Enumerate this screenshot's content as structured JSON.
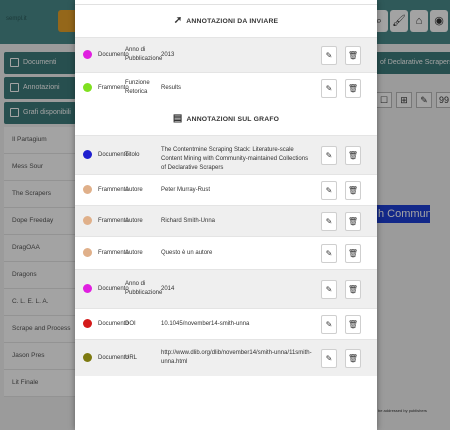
{
  "background": {
    "brand": "sempl.it",
    "top_icons": [
      {
        "icon": "search-icon",
        "glyph": "⌕"
      },
      {
        "icon": "brush-icon",
        "glyph": "🖌"
      },
      {
        "icon": "home-icon",
        "glyph": "⌂"
      },
      {
        "icon": "eye-icon",
        "glyph": "◉"
      }
    ],
    "sidebar": {
      "headers": [
        "Documenti",
        "Annotazioni",
        "Grafi disponibili"
      ],
      "items": [
        "Il Partagium",
        "Mess Sour",
        "The Scrapers",
        "Dope Freeday",
        "DragOAA",
        "Dragons",
        "C. L. E. L. A.",
        "Scrape and Process",
        "Jason Pres",
        "Lit Finale"
      ]
    },
    "right_panel": {
      "title": "of Declarative Scrapers",
      "tools": [
        "☐",
        "⊞",
        "✎",
        "99"
      ],
      "highlight_text": "h Community-",
      "note": "be addressed by publishers"
    }
  },
  "modal": {
    "sections": [
      {
        "title": "ANNOTAZIONI DA INVIARE",
        "icon": "➚",
        "icon_name": "send-icon",
        "rows": [
          {
            "color": "#e020e0",
            "type": "Documento",
            "property": "Anno di Pubblicazione",
            "value": "2013"
          },
          {
            "color": "#80e020",
            "type": "Frammento",
            "property": "Funzione Retorica",
            "value": "Results"
          }
        ]
      },
      {
        "title": "ANNOTAZIONI SUL GRAFO",
        "icon": "▤",
        "icon_name": "database-icon",
        "rows": [
          {
            "color": "#1f1fcf",
            "type": "Documento",
            "property": "Titolo",
            "value": "The Contentmine Scraping Stack: Literature-scale Content Mining with Community-maintained Collections of Declarative Scrapers"
          },
          {
            "color": "#e0b08a",
            "type": "Frammento",
            "property": "Autore",
            "value": "Peter Murray-Rust"
          },
          {
            "color": "#e0b08a",
            "type": "Frammento",
            "property": "Autore",
            "value": "Richard Smith-Unna"
          },
          {
            "color": "#e0b08a",
            "type": "Frammento",
            "property": "Autore",
            "value": "Questo è un autore"
          },
          {
            "color": "#e020e0",
            "type": "Documento",
            "property": "Anno di Pubblicazione",
            "value": "2014"
          },
          {
            "color": "#d41a1a",
            "type": "Documento",
            "property": "DOI",
            "value": "10.1045/november14-smith-unna"
          },
          {
            "color": "#7d7a10",
            "type": "Documento",
            "property": "URL",
            "value": "http://www.dlib.org/dlib/november14/smith-unna/11smith-unna.html"
          }
        ]
      }
    ],
    "edit_glyph": "✎",
    "delete_glyph": "🗑"
  }
}
